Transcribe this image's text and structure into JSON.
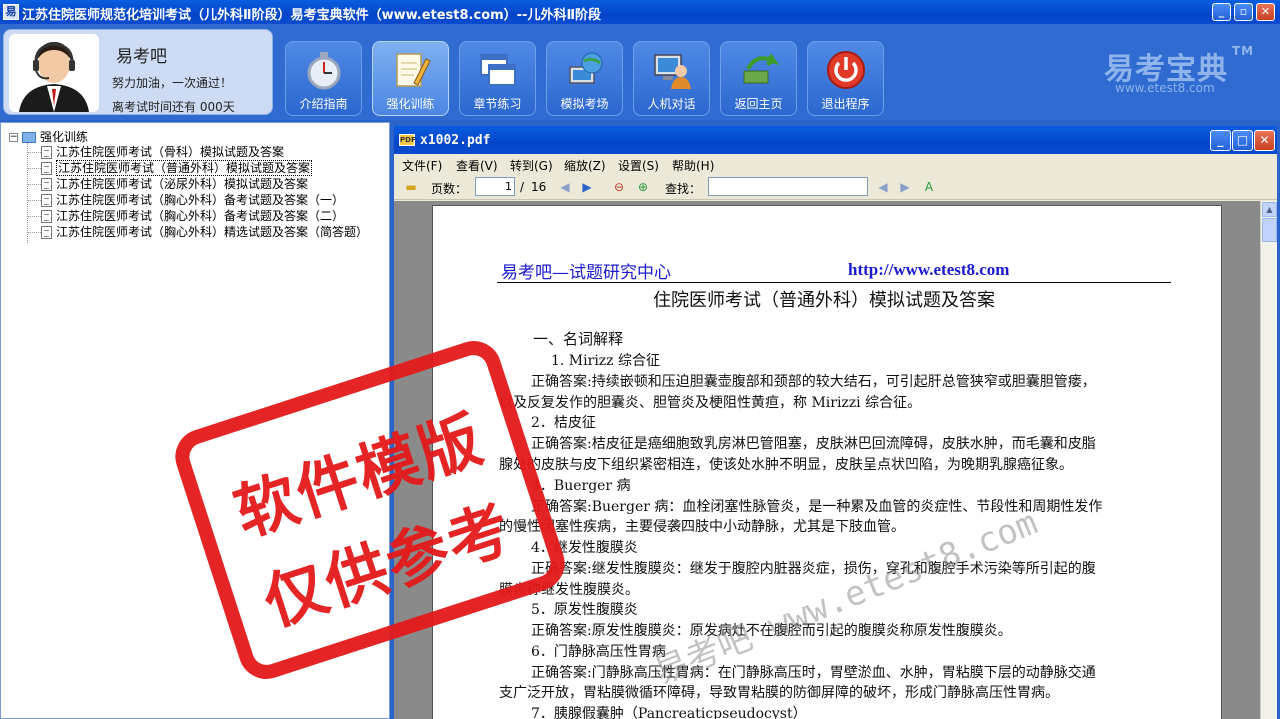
{
  "app": {
    "title": "江苏住院医师规范化培训考试（儿外科Ⅱ阶段）易考宝典软件（www.etest8.com）--儿外科Ⅱ阶段",
    "icon_text": "易",
    "min": "_",
    "max": "▫",
    "close": "✕"
  },
  "profile": {
    "name": "易考吧",
    "motto": "努力加油，一次通过！",
    "days_text": "离考试时间还有 000天"
  },
  "nav": [
    {
      "label": "介绍指南",
      "icon": "stopwatch-icon"
    },
    {
      "label": "强化训练",
      "icon": "notepad-pencil-icon",
      "active": true
    },
    {
      "label": "章节练习",
      "icon": "windows-icon"
    },
    {
      "label": "模拟考场",
      "icon": "globe-computer-icon"
    },
    {
      "label": "人机对话",
      "icon": "user-computer-icon"
    },
    {
      "label": "返回主页",
      "icon": "back-arrow-icon"
    },
    {
      "label": "退出程序",
      "icon": "power-icon"
    }
  ],
  "brand": {
    "name": "易考宝典",
    "tm": "TM",
    "url": "www.etest8.com"
  },
  "tree": {
    "root": "强化训练",
    "expander": "−",
    "items": [
      "江苏住院医师考试（骨科）模拟试题及答案",
      "江苏住院医师考试（普通外科）模拟试题及答案",
      "江苏住院医师考试（泌尿外科）模拟试题及答案",
      "江苏住院医师考试（胸心外科）备考试题及答案（一）",
      "江苏住院医师考试（胸心外科）备考试题及答案（二）",
      "江苏住院医师考试（胸心外科）精选试题及答案（简答题）"
    ]
  },
  "pdf": {
    "filename": "x1002.pdf",
    "icon_text": "PDF",
    "menu": [
      "文件(F)",
      "查看(V)",
      "转到(G)",
      "缩放(Z)",
      "设置(S)",
      "帮助(H)"
    ],
    "pages_label": "页数：",
    "current_page": "1",
    "page_sep": "/",
    "total_pages": "16",
    "find_label": "查找：",
    "find_value": "",
    "min": "_",
    "max": "□",
    "close": "✕"
  },
  "doc": {
    "header_left": "易考吧—试题研究中心",
    "header_right": "http://www.etest8.com",
    "title": "住院医师考试（普通外科）模拟试题及答案",
    "section": "一、名词解释",
    "lines": [
      "1. Mirizz 综合征",
      "正确答案:持续嵌顿和压迫胆囊壶腹部和颈部的较大结石，可引起肝总管狭窄或胆囊胆管瘘，",
      "以及反复发作的胆囊炎、胆管炎及梗阻性黄疸，称 Mirizzi 综合征。",
      "2．桔皮征",
      "正确答案:桔皮征是癌细胞致乳房淋巴管阻塞，皮肤淋巴回流障碍，皮肤水肿，而毛囊和皮脂",
      "腺处的皮肤与皮下组织紧密相连，使该处水肿不明显，皮肤呈点状凹陷，为晚期乳腺癌征象。",
      "3．Buerger 病",
      "正确答案:Buerger 病：血栓闭塞性脉管炎，是一种累及血管的炎症性、节段性和周期性发作",
      "的慢性闭塞性疾病，主要侵袭四肢中小动静脉，尤其是下肢血管。",
      "4．继发性腹膜炎",
      "正确答案:继发性腹膜炎：继发于腹腔内脏器炎症，损伤，穿孔和腹腔手术污染等所引起的腹",
      "膜炎称继发性腹膜炎。",
      "5．原发性腹膜炎",
      "正确答案:原发性腹膜炎：原发病灶不在腹腔而引起的腹膜炎称原发性腹膜炎。",
      "6．门静脉高压性胃病",
      "正确答案:门静脉高压性胃病：在门静脉高压时，胃壁淤血、水肿，胃粘膜下层的动静脉交通",
      "支广泛开放，胃粘膜微循环障碍，导致胃粘膜的防御屏障的破坏，形成门静脉高压性胃病。",
      "7．胰腺假囊肿（Pancreaticpseudocyst）"
    ]
  },
  "watermark": {
    "stamp_line1": "软件模版",
    "stamp_line2": "仅供参考",
    "url": "易考吧 www.etest8.com"
  }
}
